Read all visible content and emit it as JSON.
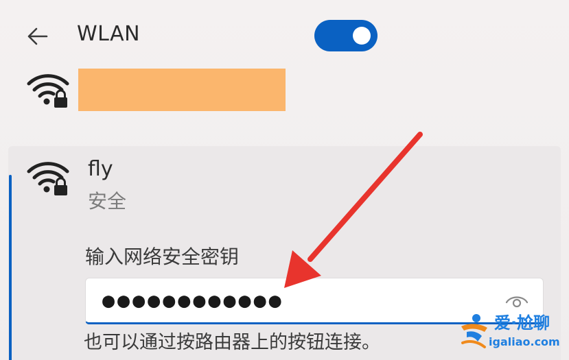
{
  "colors": {
    "accent": "#0a61c2",
    "redaction": "#fbb66d",
    "arrow": "#e8342d",
    "watermark": "#1f7fe0"
  },
  "header": {
    "back_icon": "arrow-left-icon",
    "title": "WLAN",
    "wifi_toggle_on": true
  },
  "networks": [
    {
      "icon": "wifi-secured-icon",
      "name_redacted": true
    },
    {
      "icon": "wifi-secured-icon",
      "name": "fly",
      "security": "安全",
      "password_prompt": "输入网络安全密钥",
      "password_masked": "●●●●●●●●●●●●",
      "reveal_icon": "eye-icon",
      "hint": "也可以通过按路由器上的按钮连接。"
    }
  ],
  "watermark": {
    "line1": "爱·尬聊",
    "line2": "igaliao.com"
  }
}
